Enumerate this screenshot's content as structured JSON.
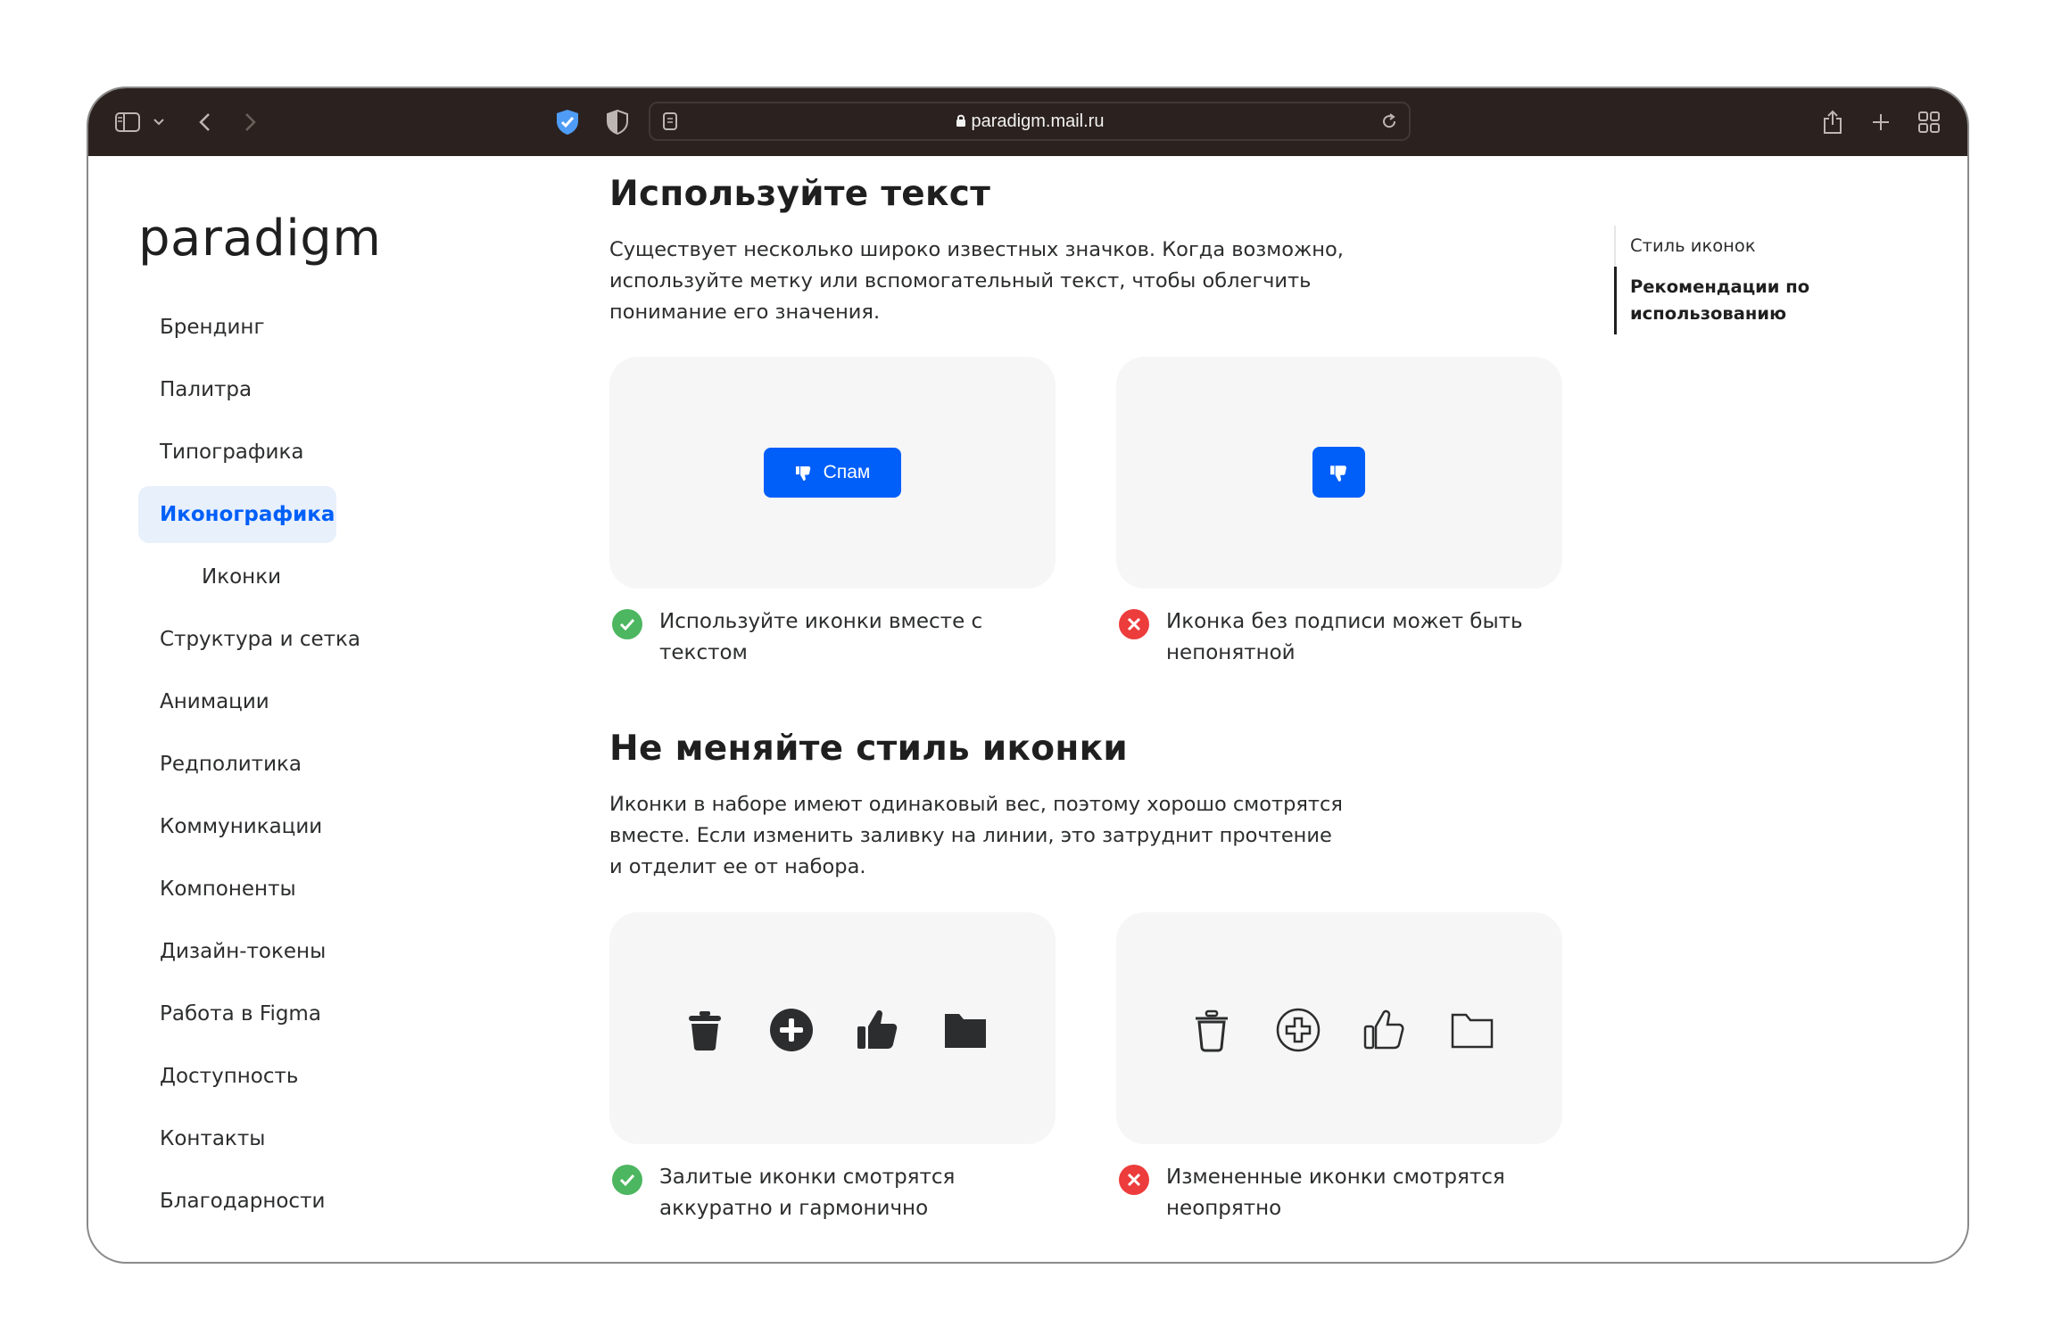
{
  "browser": {
    "url": "paradigm.mail.ru"
  },
  "sidebar": {
    "logo": "paradigm",
    "items": [
      {
        "label": "Брендинг"
      },
      {
        "label": "Палитра"
      },
      {
        "label": "Типографика"
      },
      {
        "label": "Иконографика"
      },
      {
        "label": "Иконки"
      },
      {
        "label": "Структура и сетка"
      },
      {
        "label": "Анимации"
      },
      {
        "label": "Редполитика"
      },
      {
        "label": "Коммуникации"
      },
      {
        "label": "Компоненты"
      },
      {
        "label": "Дизайн-токены"
      },
      {
        "label": "Работа в Figma"
      },
      {
        "label": "Доступность"
      },
      {
        "label": "Контакты"
      },
      {
        "label": "Благодарности"
      }
    ]
  },
  "main": {
    "section1": {
      "title": "Используйте текст",
      "text": "Существует несколько широко известных значков. Когда возможно, используйте метку или вспомогательный текст, чтобы облегчить понимание его значения.",
      "good_example": {
        "button_label": "Спам",
        "caption": "Используйте иконки вместе с текстом"
      },
      "bad_example": {
        "caption": "Иконка без подписи может быть непонятной"
      }
    },
    "section2": {
      "title": "Не меняйте стиль иконки",
      "text": "Иконки в наборе имеют одинаковый вес, поэтому хорошо смотрятся вместе. Если изменить заливку на линии, это затруднит прочтение и отделит ее от набора.",
      "good_example": {
        "caption": "Залитые иконки смотрятся аккуратно и гармонично"
      },
      "bad_example": {
        "caption": "Измененные иконки смотрятся неопрятно"
      }
    }
  },
  "toc": {
    "items": [
      {
        "label": "Стиль иконок"
      },
      {
        "label": "Рекомендации по использованию"
      }
    ]
  },
  "colors": {
    "accent": "#005ff9",
    "success": "#4cb660",
    "error": "#ed3c3c",
    "titlebar": "#2b211e"
  }
}
